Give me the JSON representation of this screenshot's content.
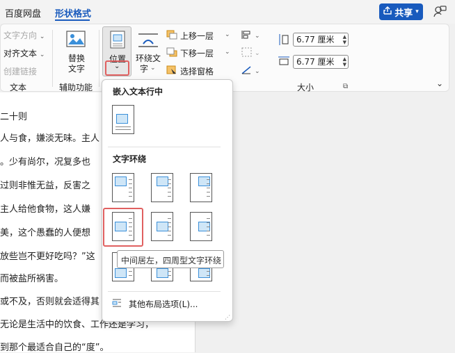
{
  "tabs": {
    "baidu": "百度网盘",
    "shape_format": "形状格式"
  },
  "share": {
    "label": "共享"
  },
  "ribbon": {
    "text_direction": "文字方向",
    "align_text": "对齐文本",
    "create_link": "创建链接",
    "group_text": "文本",
    "alt_text_line1": "替换",
    "alt_text_line2": "文字",
    "group_accessibility": "辅助功能",
    "position": "位置",
    "wrap_text_line1": "环绕文",
    "wrap_text_line2": "字",
    "bring_forward": "上移一层",
    "send_backward": "下移一层",
    "selection_pane": "选择窗格",
    "height_value": "6.77 厘米",
    "width_value": "6.77 厘米",
    "group_size": "大小"
  },
  "document": {
    "lines": [
      "二十则",
      "人与食，嫌淡无味。主人",
      "。少有尚尔，况复多也",
      "过则非惟无益，反害之",
      "主人给他食物，这人嫌",
      "美，这个愚蠢的人便想",
      "放些岂不更好吃吗？”这",
      "而被盐所祸害。",
      "或不及，否则就会适得其",
      "无论是生活中的饮食、工作还是学习，",
      "到那个最适合自己的“度”。"
    ]
  },
  "menu": {
    "inline_header": "嵌入文本行中",
    "wrap_header": "文字环绕",
    "tooltip": "中间居左，四周型文字环绕",
    "more_options": "其他布局选项(L)..."
  }
}
